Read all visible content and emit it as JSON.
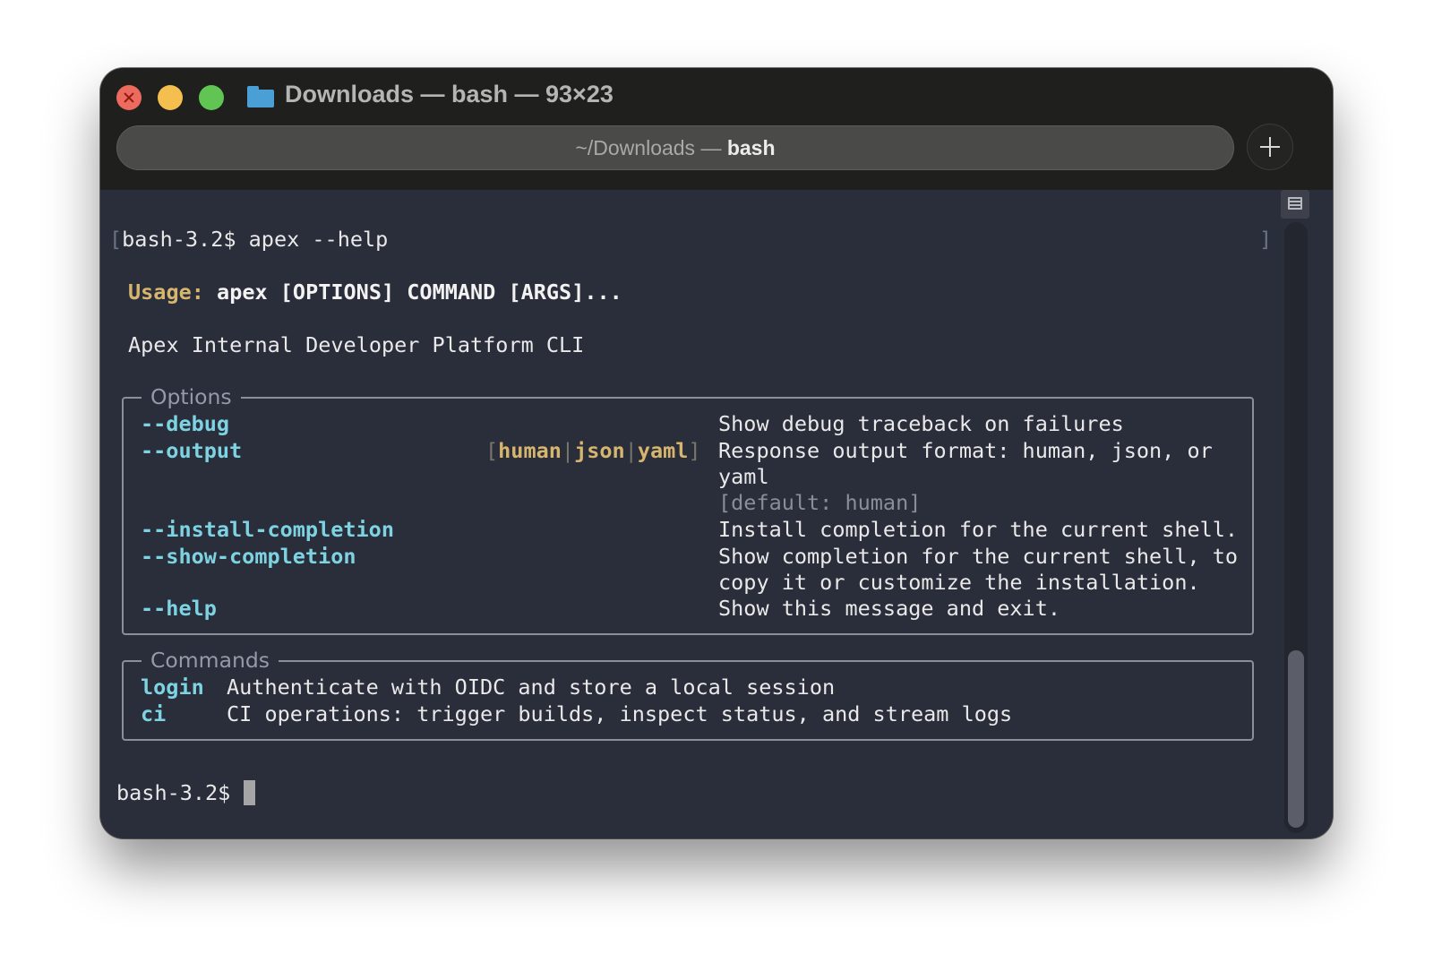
{
  "window": {
    "title": "Downloads — bash — 93×23",
    "tab": {
      "path": "~/Downloads — ",
      "process": "bash"
    }
  },
  "terminal": {
    "prompt": "bash-3.2$",
    "command": "apex --help",
    "open_bracket": "[",
    "close_bracket": "]",
    "usage_label": "Usage:",
    "usage_text": "apex [OPTIONS] COMMAND [ARGS]...",
    "description": "Apex Internal Developer Platform CLI",
    "options_title": "Options",
    "options": {
      "debug": {
        "flag": "--debug",
        "help": "Show debug traceback on failures"
      },
      "output": {
        "flag": "--output",
        "choices": [
          "human",
          "json",
          "yaml"
        ],
        "bracket_open": "[",
        "bracket_close": "]",
        "pipe": "|",
        "help_line1": "Response output format: human, json, or",
        "help_line2": "yaml",
        "default": "[default: human]"
      },
      "install_completion": {
        "flag": "--install-completion",
        "help": "Install completion for the current shell."
      },
      "show_completion": {
        "flag": "--show-completion",
        "help_line1": "Show completion for the current shell, to",
        "help_line2": "copy it or customize the installation."
      },
      "help": {
        "flag": "--help",
        "help": "Show this message and exit."
      }
    },
    "commands_title": "Commands",
    "commands": {
      "login": {
        "name": "login",
        "help": "Authenticate with OIDC and store a local session"
      },
      "ci": {
        "name": "ci",
        "help": "CI operations: trigger builds, inspect status, and stream logs"
      }
    }
  },
  "colors": {
    "terminal_bg": "#2a2d3a",
    "option_flag": "#7dd3e2",
    "usage_accent": "#d6b56d",
    "titlebar_bg": "#1f201e"
  },
  "icons": {
    "close": "close-icon",
    "minimize": "minimize-icon",
    "maximize": "maximize-icon",
    "folder": "folder-icon",
    "new_tab": "plus-icon",
    "sidebar": "sidebar-icon"
  }
}
